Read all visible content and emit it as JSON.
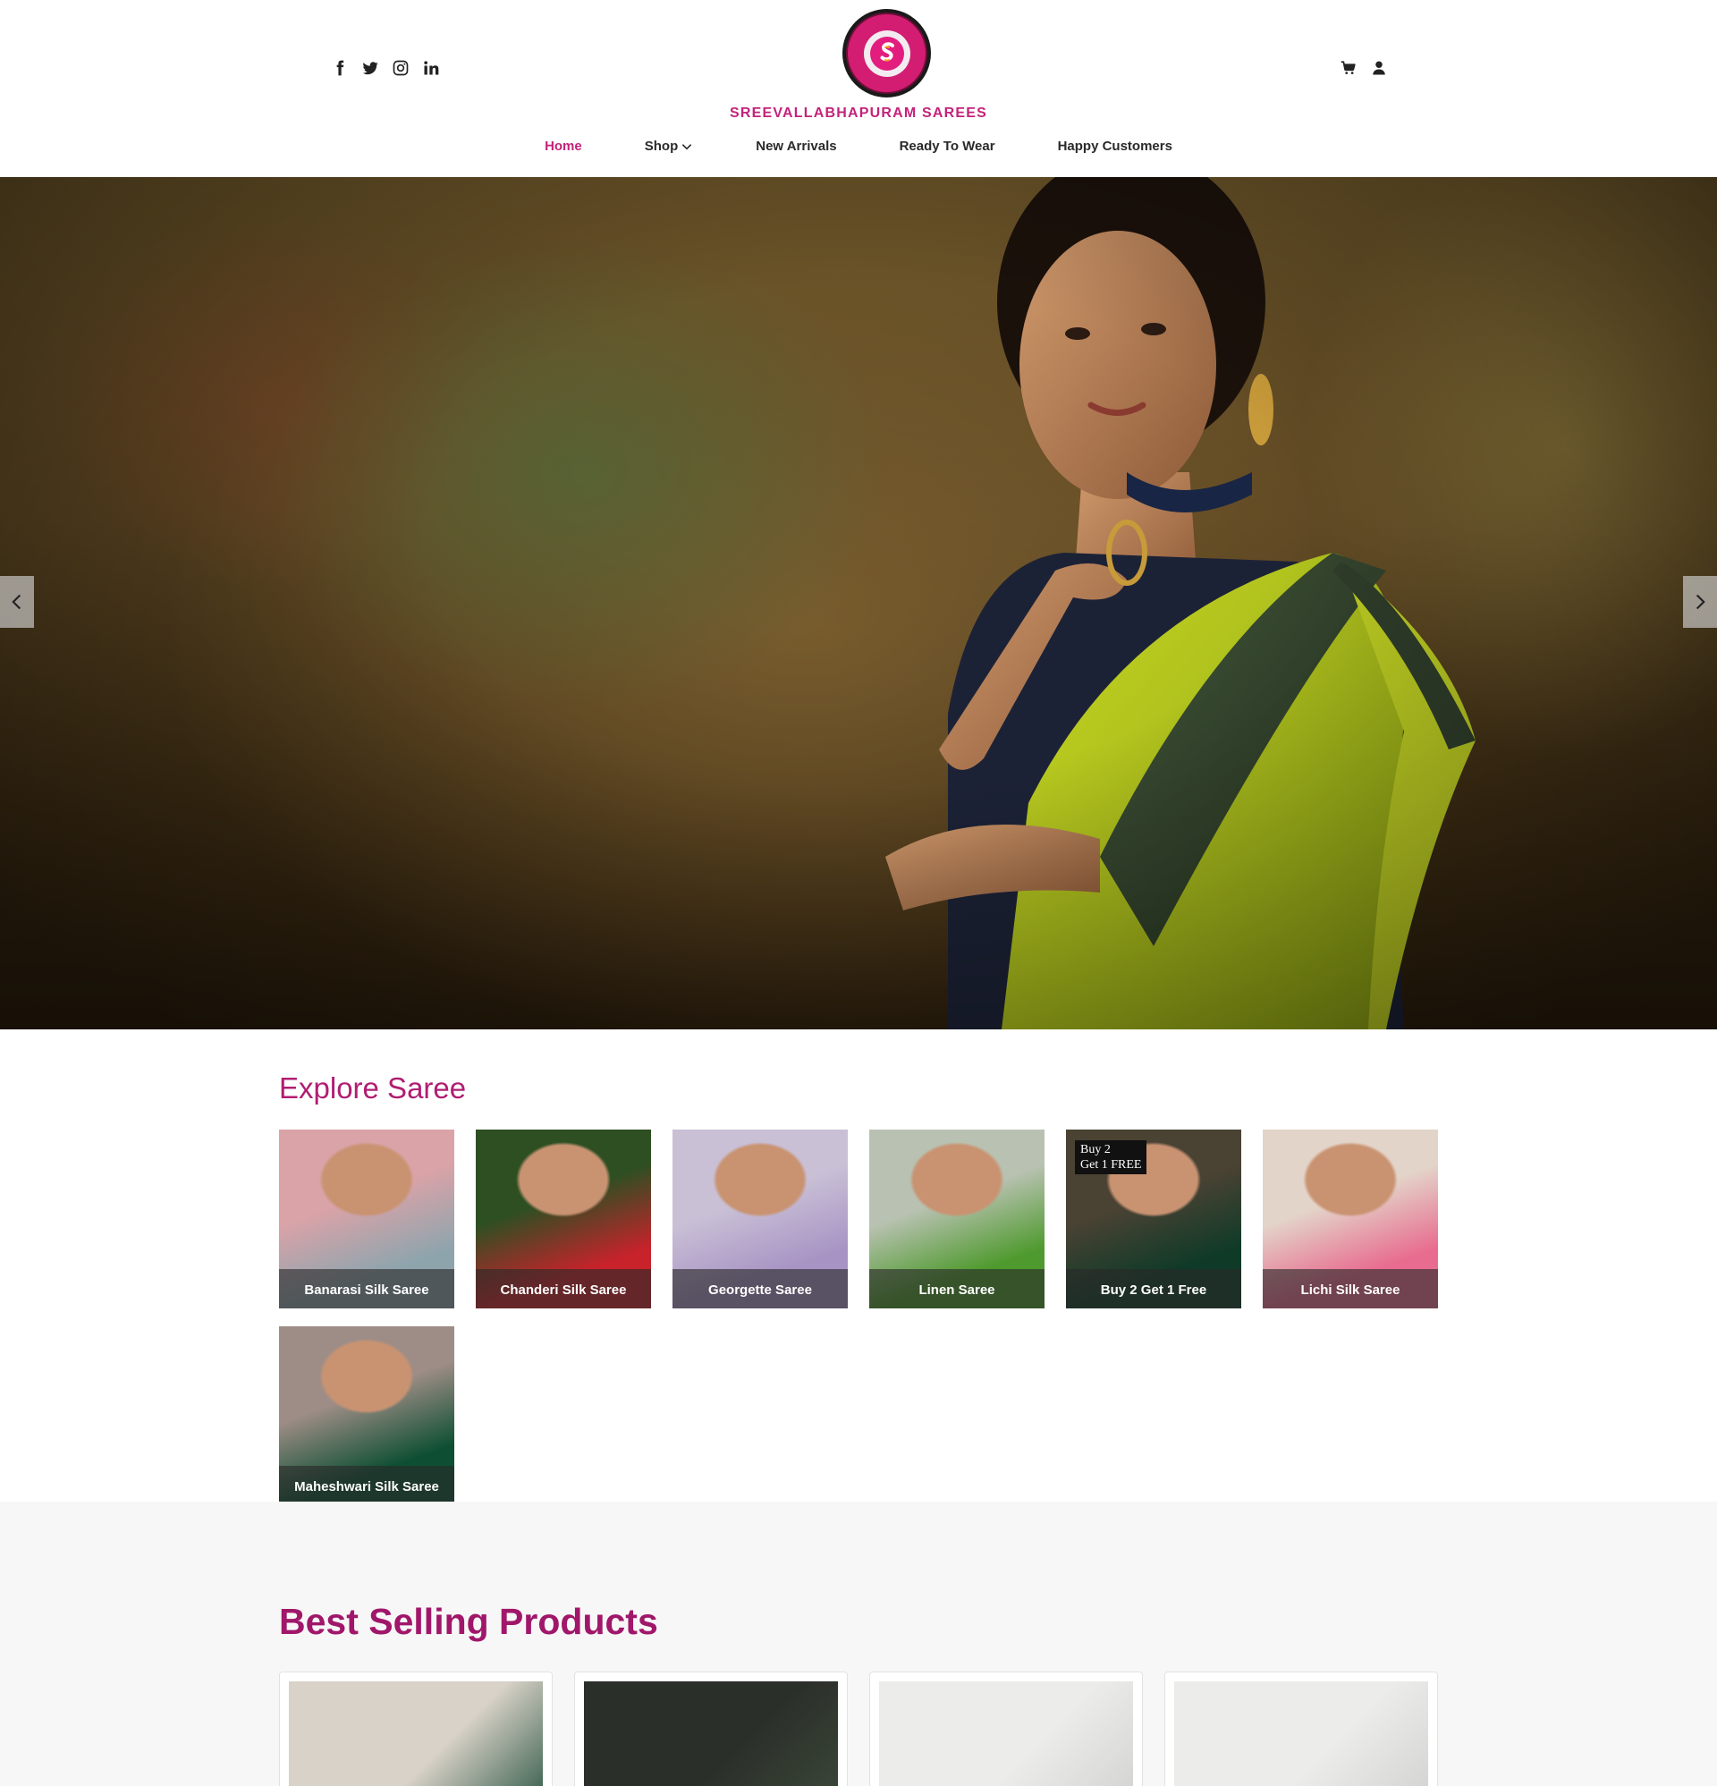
{
  "header": {
    "brand": "SREEVALLABHAPURAM SAREES",
    "social_icons": [
      "facebook-icon",
      "twitter-icon",
      "instagram-icon",
      "linkedin-icon"
    ],
    "right_icons": [
      "cart-icon",
      "user-icon"
    ]
  },
  "nav": {
    "items": [
      {
        "label": "Home",
        "active": true
      },
      {
        "label": "Shop",
        "has_dropdown": true
      },
      {
        "label": "New Arrivals"
      },
      {
        "label": "Ready To Wear"
      },
      {
        "label": "Happy Customers"
      }
    ]
  },
  "hero": {
    "prev_icon": "chevron-left-icon",
    "next_icon": "chevron-right-icon"
  },
  "explore": {
    "title": "Explore Saree",
    "categories": [
      {
        "label": "Banarasi Silk Saree",
        "colors": [
          "#d9a3a8",
          "#8ea4ad"
        ]
      },
      {
        "label": "Chanderi Silk Saree",
        "colors": [
          "#2e4f22",
          "#c8222b"
        ]
      },
      {
        "label": "Georgette Saree",
        "colors": [
          "#c9c0d6",
          "#a894c4"
        ]
      },
      {
        "label": "Linen Saree",
        "colors": [
          "#b9c2b2",
          "#4f9a2e"
        ]
      },
      {
        "label": "Buy 2 Get 1 Free",
        "badge_line1": "Buy 2",
        "badge_line2": "Get 1 FREE",
        "colors": [
          "#4a4233",
          "#0f3a28"
        ]
      },
      {
        "label": "Lichi Silk Saree",
        "colors": [
          "#e3d4c9",
          "#e86c8f"
        ]
      },
      {
        "label": "Maheshwari Silk Saree",
        "colors": [
          "#9e8d86",
          "#0e4f33"
        ]
      }
    ]
  },
  "best_selling": {
    "title": "Best Selling Products",
    "products": [
      {
        "colors": [
          "#d9d2c8",
          "#1f4d3a"
        ]
      },
      {
        "colors": [
          "#2b2f2a",
          "#3d4a3a"
        ]
      },
      {
        "colors": [
          "#ececea",
          "#cfcfcd"
        ]
      },
      {
        "colors": [
          "#ececea",
          "#cfcfcd"
        ]
      }
    ]
  },
  "colors": {
    "accent": "#c4227a",
    "title": "#a0176a"
  }
}
